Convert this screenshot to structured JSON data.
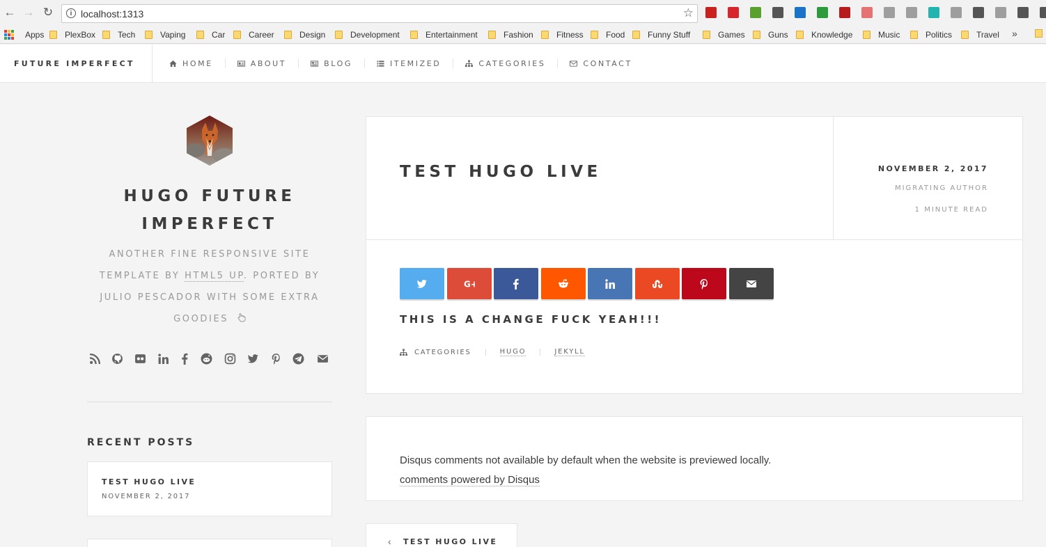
{
  "browser": {
    "url": "localhost:1313",
    "bookmarks": [
      {
        "label": "Apps",
        "icon": "apps-grid-icon"
      },
      {
        "label": "PlexBox"
      },
      {
        "label": "Tech"
      },
      {
        "label": "Vaping"
      },
      {
        "label": "Car"
      },
      {
        "label": "Career"
      },
      {
        "label": "Design"
      },
      {
        "label": "Development"
      },
      {
        "label": "Entertainment"
      },
      {
        "label": "Fashion"
      },
      {
        "label": "Fitness"
      },
      {
        "label": "Food"
      },
      {
        "label": "Funny Stuff"
      },
      {
        "label": "Games"
      },
      {
        "label": "Guns"
      },
      {
        "label": "Knowledge"
      },
      {
        "label": "Music"
      },
      {
        "label": "Politics"
      },
      {
        "label": "Travel"
      }
    ],
    "overflow": "»",
    "extension_colors": [
      "#c8211e",
      "#d6262c",
      "#5aa02c",
      "#555555",
      "#1a73c8",
      "#2e9a3e",
      "#b71c1c",
      "#e57373",
      "#9e9e9e",
      "#9e9e9e",
      "#22b5b0",
      "#9e9e9e",
      "#555555",
      "#9e9e9e",
      "#555555",
      "#555555"
    ]
  },
  "site": {
    "logo": "FUTURE IMPERFECT",
    "nav": [
      {
        "label": "HOME",
        "icon": "home-icon"
      },
      {
        "label": "ABOUT",
        "icon": "id-card-icon"
      },
      {
        "label": "BLOG",
        "icon": "newspaper-icon"
      },
      {
        "label": "ITEMIZED",
        "icon": "list-icon"
      },
      {
        "label": "CATEGORIES",
        "icon": "sitemap-icon"
      },
      {
        "label": "CONTACT",
        "icon": "envelope-icon"
      }
    ]
  },
  "sidebar": {
    "title_line1": "HUGO FUTURE",
    "title_line2": "IMPERFECT",
    "tagline_line1": "ANOTHER FINE RESPONSIVE SITE",
    "tagline_line2_pre": "TEMPLATE BY ",
    "tagline_link": "HTML5 UP",
    "tagline_line2_post": ". PORTED BY",
    "tagline_line3": "JULIO PESCADOR WITH SOME EXTRA",
    "tagline_line4": "GOODIES",
    "social_icons": [
      "rss-icon",
      "github-icon",
      "flickr-icon",
      "linkedin-icon",
      "facebook-icon",
      "reddit-icon",
      "instagram-icon",
      "twitter-icon",
      "pinterest-icon",
      "telegram-icon",
      "email-icon"
    ],
    "recent_heading": "RECENT POSTS",
    "recent_posts": [
      {
        "title": "TEST HUGO LIVE",
        "date": "NOVEMBER 2, 2017"
      }
    ]
  },
  "post": {
    "title": "TEST HUGO LIVE",
    "date": "NOVEMBER 2, 2017",
    "author": "MIGRATING AUTHOR",
    "read_time": "1 MINUTE READ",
    "body": "THIS IS A CHANGE FUCK YEAH!!!",
    "categories_label": "CATEGORIES",
    "tags": [
      "HUGO",
      "JEKYLL"
    ],
    "share_buttons": [
      {
        "name": "twitter",
        "color": "#55acee"
      },
      {
        "name": "google-plus",
        "color": "#dd4b39"
      },
      {
        "name": "facebook",
        "color": "#3b5998"
      },
      {
        "name": "reddit",
        "color": "#ff5700"
      },
      {
        "name": "linkedin",
        "color": "#4875b4"
      },
      {
        "name": "stumbleupon",
        "color": "#eb4924"
      },
      {
        "name": "pinterest",
        "color": "#bd081c"
      },
      {
        "name": "email",
        "color": "#444444"
      }
    ]
  },
  "comments": {
    "notice": "Disqus comments not available by default when the website is previewed locally.",
    "powered": "comments powered by Disqus"
  },
  "pager": {
    "prev_label": "TEST HUGO LIVE"
  }
}
